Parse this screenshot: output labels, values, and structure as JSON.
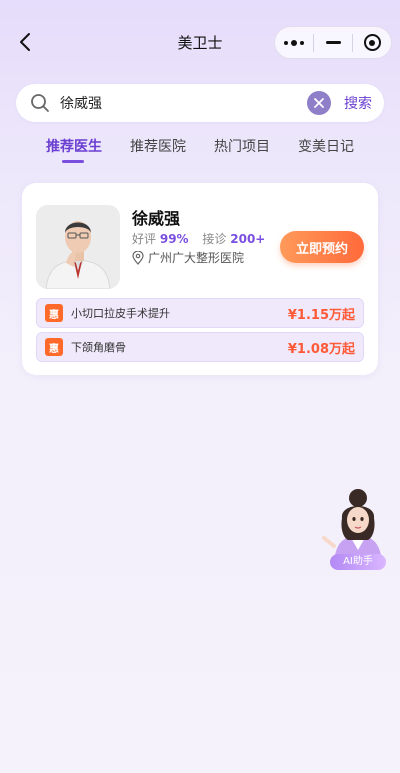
{
  "app": {
    "title": "美卫士"
  },
  "search": {
    "value": "徐威强",
    "button_label": "搜索"
  },
  "tabs": [
    {
      "label": "推荐医生",
      "active": true
    },
    {
      "label": "推荐医院",
      "active": false
    },
    {
      "label": "热门项目",
      "active": false
    },
    {
      "label": "变美日记",
      "active": false
    }
  ],
  "doctor": {
    "name": "徐威强",
    "rating_label": "好评",
    "rating_value": "99%",
    "consult_label": "接诊",
    "consult_value": "200+",
    "hospital": "广州广大整形医院",
    "book_label": "立即预约",
    "projects": [
      {
        "badge": "惠",
        "name": "小切口拉皮手术提升",
        "price": "¥1.15万起"
      },
      {
        "badge": "惠",
        "name": "下颌角磨骨",
        "price": "¥1.08万起"
      }
    ]
  },
  "ai": {
    "label": "AI助手"
  },
  "colors": {
    "accent": "#6a3fd1",
    "price": "#ff5a38",
    "button": "#ff7a44"
  }
}
